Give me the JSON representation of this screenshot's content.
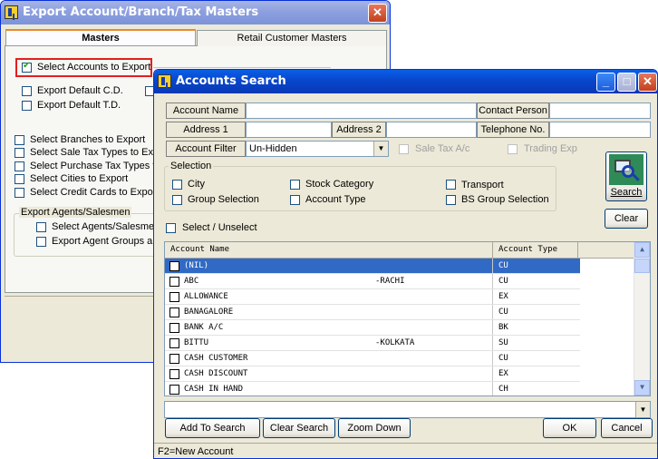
{
  "back_window": {
    "title": "Export Account/Branch/Tax Masters",
    "tabs": [
      "Masters",
      "Retail Customer Masters"
    ],
    "select_accounts_label": "Select Accounts to Export",
    "export_default_cd": "Export Default C.D.",
    "export_default_td": "Export Default T.D.",
    "options": [
      "Select Branches to Export",
      "Select Sale Tax Types to Exp",
      "Select Purchase Tax Types t",
      "Select Cities to Export",
      "Select Credit Cards to Export"
    ],
    "agents_group_title": "Export Agents/Salesmen",
    "select_agents": "Select Agents/Salesmen",
    "export_agent_groups": "Export Agent Groups als"
  },
  "search_window": {
    "title": "Accounts Search",
    "labels": {
      "account_name": "Account Name",
      "contact_person": "Contact Person",
      "address1": "Address 1",
      "address2": "Address 2",
      "telephone": "Telephone No.",
      "account_filter": "Account Filter"
    },
    "account_filter_value": "Un-Hidden",
    "sale_tax": "Sale Tax A/c",
    "trading_exp": "Trading Exp",
    "selection_title": "Selection",
    "selection": {
      "city": "City",
      "group_selection": "Group Selection",
      "stock_category": "Stock Category",
      "account_type": "Account Type",
      "transport": "Transport",
      "bs_group_selection": "BS Group Selection"
    },
    "search_button": "Search",
    "clear_button": "Clear",
    "select_unselect": "Select / Unselect",
    "grid": {
      "col_name": "Account Name",
      "col_type": "Account Type",
      "rows": [
        {
          "name": "(NIL)",
          "city": "",
          "type": "CU"
        },
        {
          "name": "ABC",
          "city": "-RACHI",
          "type": "CU"
        },
        {
          "name": "ALLOWANCE",
          "city": "",
          "type": "EX"
        },
        {
          "name": "BANAGALORE",
          "city": "",
          "type": "CU"
        },
        {
          "name": "BANK A/C",
          "city": "",
          "type": "BK"
        },
        {
          "name": "BITTU",
          "city": "-KOLKATA",
          "type": "SU"
        },
        {
          "name": "CASH CUSTOMER",
          "city": "",
          "type": "CU"
        },
        {
          "name": "CASH DISCOUNT",
          "city": "",
          "type": "EX"
        },
        {
          "name": "CASH IN HAND",
          "city": "",
          "type": "CH"
        }
      ]
    },
    "add_to_search": "Add To Search",
    "clear_search": "Clear Search",
    "zoom_down": "Zoom Down",
    "ok": "OK",
    "cancel": "Cancel",
    "status": "F2=New Account"
  }
}
